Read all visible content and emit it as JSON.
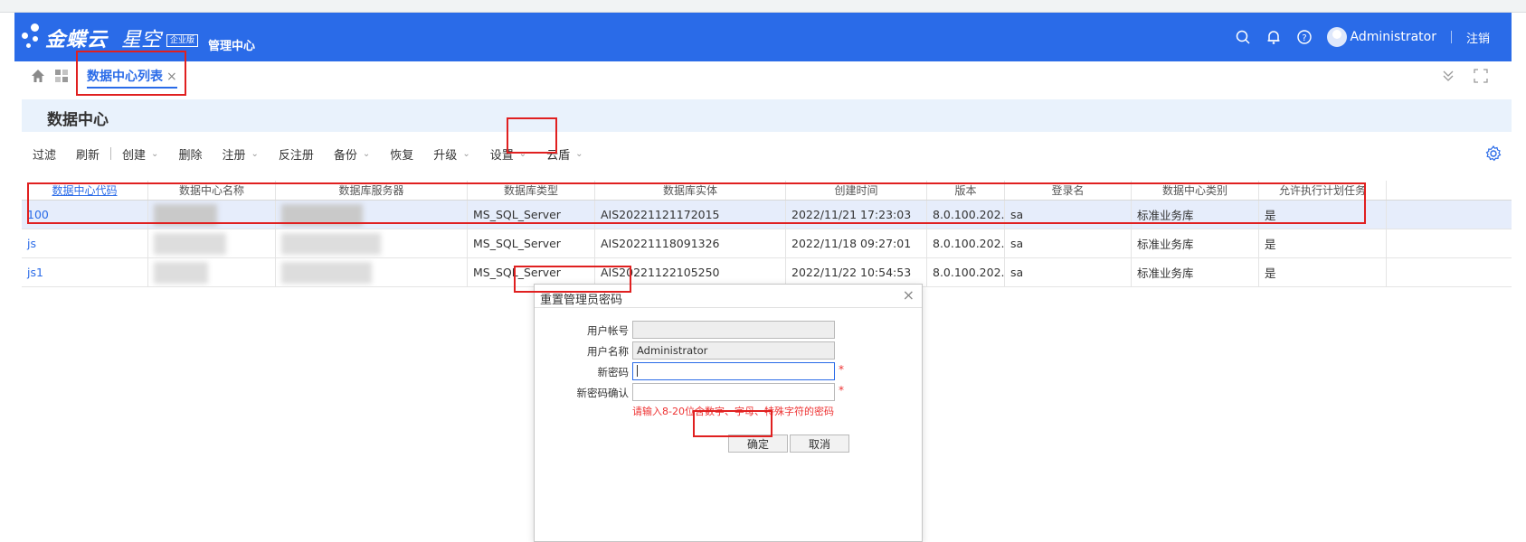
{
  "app": {
    "brand": "金蝶云",
    "brand_sub": "星空",
    "edition": "企业版",
    "module": "管理中心",
    "user": "Administrator",
    "logout": "注销"
  },
  "tabs": {
    "active_label": "数据中心列表",
    "close": "×"
  },
  "page": {
    "title": "数据中心"
  },
  "toolbar": {
    "items": [
      {
        "label": "过滤"
      },
      {
        "label": "刷新"
      },
      {
        "label": "创建"
      },
      {
        "label": "删除"
      },
      {
        "label": "注册"
      },
      {
        "label": "反注册"
      },
      {
        "label": "备份"
      },
      {
        "label": "恢复"
      },
      {
        "label": "升级"
      },
      {
        "label": "设置"
      },
      {
        "label": "云盾"
      }
    ]
  },
  "table": {
    "columns": [
      "数据中心代码",
      "数据中心名称",
      "数据库服务器",
      "数据库类型",
      "数据库实体",
      "创建时间",
      "版本",
      "登录名",
      "数据中心类别",
      "允许执行计划任务"
    ],
    "rows": [
      {
        "code": "100",
        "name": "",
        "server": "",
        "db_type": "MS_SQL_Server",
        "entity": "AIS20221121172015",
        "created": "2022/11/21 17:23:03",
        "version": "8.0.100.202...",
        "login": "sa",
        "category": "标准业务库",
        "allow_task": "是"
      },
      {
        "code": "js",
        "name": "",
        "server": "",
        "db_type": "MS_SQL_Server",
        "entity": "AIS20221118091326",
        "created": "2022/11/18 09:27:01",
        "version": "8.0.100.202...",
        "login": "sa",
        "category": "标准业务库",
        "allow_task": "是"
      },
      {
        "code": "js1",
        "name": "",
        "server": "",
        "db_type": "MS_SQL_Server",
        "entity": "AIS20221122105250",
        "created": "2022/11/22 10:54:53",
        "version": "8.0.100.202...",
        "login": "sa",
        "category": "标准业务库",
        "allow_task": "是"
      }
    ]
  },
  "dialog": {
    "title": "重置管理员密码",
    "close": "×",
    "fields": {
      "account_label": "用户帐号",
      "account_value": "",
      "username_label": "用户名称",
      "username_value": "Administrator",
      "newpwd_label": "新密码",
      "confirm_label": "新密码确认"
    },
    "required_mark": "*",
    "hint": "请输入8-20位含数字、字母、特殊字符的密码",
    "ok": "确定",
    "cancel": "取消"
  },
  "colors": {
    "accent": "#2a6be8",
    "annotation_red": "#e02020",
    "selected_row": "#e6edfb"
  }
}
